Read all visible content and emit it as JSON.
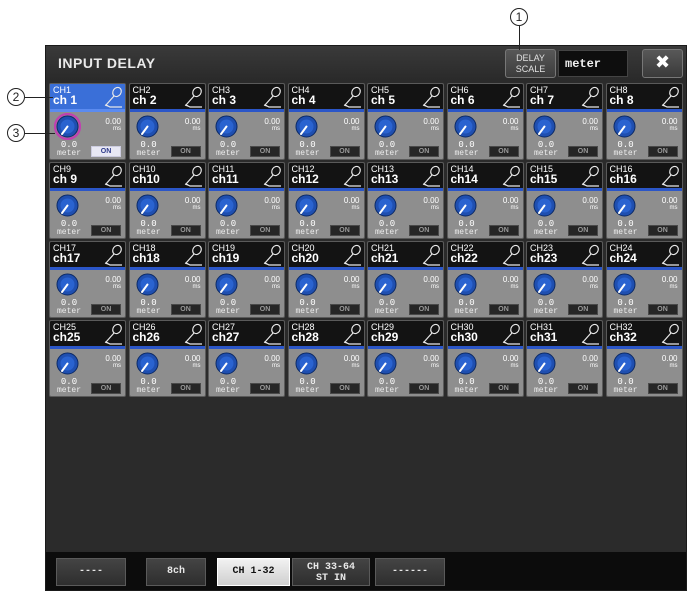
{
  "annotations": {
    "callout_1": "1",
    "callout_2": "2",
    "callout_3": "3"
  },
  "window": {
    "title": "INPUT DELAY",
    "delay_scale_label_1": "DELAY",
    "delay_scale_label_2": "SCALE",
    "delay_scale_value": "meter",
    "close_symbol": "✖"
  },
  "channels": [
    {
      "num": "CH1",
      "name": "ch 1",
      "delay": "0.0",
      "unit": "meter",
      "ms": "0.00",
      "on": "ON",
      "selected": true,
      "active": true
    },
    {
      "num": "CH2",
      "name": "ch 2",
      "delay": "0.0",
      "unit": "meter",
      "ms": "0.00",
      "on": "ON"
    },
    {
      "num": "CH3",
      "name": "ch 3",
      "delay": "0.0",
      "unit": "meter",
      "ms": "0.00",
      "on": "ON"
    },
    {
      "num": "CH4",
      "name": "ch 4",
      "delay": "0.0",
      "unit": "meter",
      "ms": "0.00",
      "on": "ON"
    },
    {
      "num": "CH5",
      "name": "ch 5",
      "delay": "0.0",
      "unit": "meter",
      "ms": "0.00",
      "on": "ON"
    },
    {
      "num": "CH6",
      "name": "ch 6",
      "delay": "0.0",
      "unit": "meter",
      "ms": "0.00",
      "on": "ON"
    },
    {
      "num": "CH7",
      "name": "ch 7",
      "delay": "0.0",
      "unit": "meter",
      "ms": "0.00",
      "on": "ON"
    },
    {
      "num": "CH8",
      "name": "ch 8",
      "delay": "0.0",
      "unit": "meter",
      "ms": "0.00",
      "on": "ON"
    },
    {
      "num": "CH9",
      "name": "ch 9",
      "delay": "0.0",
      "unit": "meter",
      "ms": "0.00",
      "on": "ON"
    },
    {
      "num": "CH10",
      "name": "ch10",
      "delay": "0.0",
      "unit": "meter",
      "ms": "0.00",
      "on": "ON"
    },
    {
      "num": "CH11",
      "name": "ch11",
      "delay": "0.0",
      "unit": "meter",
      "ms": "0.00",
      "on": "ON"
    },
    {
      "num": "CH12",
      "name": "ch12",
      "delay": "0.0",
      "unit": "meter",
      "ms": "0.00",
      "on": "ON"
    },
    {
      "num": "CH13",
      "name": "ch13",
      "delay": "0.0",
      "unit": "meter",
      "ms": "0.00",
      "on": "ON"
    },
    {
      "num": "CH14",
      "name": "ch14",
      "delay": "0.0",
      "unit": "meter",
      "ms": "0.00",
      "on": "ON"
    },
    {
      "num": "CH15",
      "name": "ch15",
      "delay": "0.0",
      "unit": "meter",
      "ms": "0.00",
      "on": "ON"
    },
    {
      "num": "CH16",
      "name": "ch16",
      "delay": "0.0",
      "unit": "meter",
      "ms": "0.00",
      "on": "ON"
    },
    {
      "num": "CH17",
      "name": "ch17",
      "delay": "0.0",
      "unit": "meter",
      "ms": "0.00",
      "on": "ON"
    },
    {
      "num": "CH18",
      "name": "ch18",
      "delay": "0.0",
      "unit": "meter",
      "ms": "0.00",
      "on": "ON"
    },
    {
      "num": "CH19",
      "name": "ch19",
      "delay": "0.0",
      "unit": "meter",
      "ms": "0.00",
      "on": "ON"
    },
    {
      "num": "CH20",
      "name": "ch20",
      "delay": "0.0",
      "unit": "meter",
      "ms": "0.00",
      "on": "ON"
    },
    {
      "num": "CH21",
      "name": "ch21",
      "delay": "0.0",
      "unit": "meter",
      "ms": "0.00",
      "on": "ON"
    },
    {
      "num": "CH22",
      "name": "ch22",
      "delay": "0.0",
      "unit": "meter",
      "ms": "0.00",
      "on": "ON"
    },
    {
      "num": "CH23",
      "name": "ch23",
      "delay": "0.0",
      "unit": "meter",
      "ms": "0.00",
      "on": "ON"
    },
    {
      "num": "CH24",
      "name": "ch24",
      "delay": "0.0",
      "unit": "meter",
      "ms": "0.00",
      "on": "ON"
    },
    {
      "num": "CH25",
      "name": "ch25",
      "delay": "0.0",
      "unit": "meter",
      "ms": "0.00",
      "on": "ON"
    },
    {
      "num": "CH26",
      "name": "ch26",
      "delay": "0.0",
      "unit": "meter",
      "ms": "0.00",
      "on": "ON"
    },
    {
      "num": "CH27",
      "name": "ch27",
      "delay": "0.0",
      "unit": "meter",
      "ms": "0.00",
      "on": "ON"
    },
    {
      "num": "CH28",
      "name": "ch28",
      "delay": "0.0",
      "unit": "meter",
      "ms": "0.00",
      "on": "ON"
    },
    {
      "num": "CH29",
      "name": "ch29",
      "delay": "0.0",
      "unit": "meter",
      "ms": "0.00",
      "on": "ON"
    },
    {
      "num": "CH30",
      "name": "ch30",
      "delay": "0.0",
      "unit": "meter",
      "ms": "0.00",
      "on": "ON"
    },
    {
      "num": "CH31",
      "name": "ch31",
      "delay": "0.0",
      "unit": "meter",
      "ms": "0.00",
      "on": "ON"
    },
    {
      "num": "CH32",
      "name": "ch32",
      "delay": "0.0",
      "unit": "meter",
      "ms": "0.00",
      "on": "ON"
    }
  ],
  "tabs": [
    {
      "line1": "----",
      "line2": ""
    },
    {
      "line1": "8ch",
      "line2": ""
    },
    {
      "line1": "CH 1-32",
      "line2": "",
      "selected": true
    },
    {
      "line1": "CH 33-64",
      "line2": "ST IN"
    },
    {
      "line1": "------",
      "line2": ""
    }
  ],
  "colors": {
    "selected_channel": "#3a6fd8",
    "channel_bar": "#2b56c8",
    "knob_fill": "#1f4fb0",
    "knob_focus_ring": "#c040b0",
    "panel_bg": "#2b2b2b"
  },
  "icons": {
    "channel_icon": "microphone-icon",
    "close_icon": "close-icon"
  }
}
